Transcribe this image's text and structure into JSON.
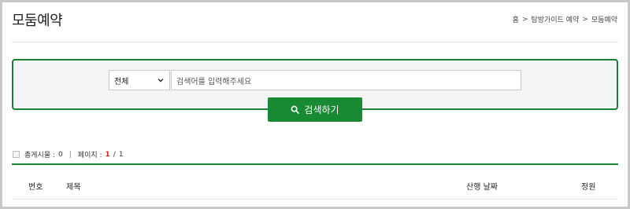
{
  "page": {
    "title": "모둠예약"
  },
  "breadcrumb": {
    "home": "홈",
    "level1": "탐방가이드 예약",
    "level2": "모둠예약"
  },
  "search": {
    "select_value": "전체",
    "input_placeholder": "검색어를 입력해주세요",
    "button_label": "검색하기"
  },
  "status": {
    "total_label": "총게시물 :",
    "total_value": "0",
    "page_label": "페이지 :",
    "current_page": "1",
    "page_sep": "/",
    "total_pages": "1"
  },
  "table": {
    "headers": {
      "number": "번호",
      "title": "제목",
      "date": "산행 날짜",
      "capacity": "정원"
    }
  },
  "colors": {
    "accent": "#178a33",
    "border_accent": "#1c7f34",
    "current_page": "#dd2222"
  },
  "icons": {
    "search": "search-icon",
    "select": "chevron-down-icon"
  }
}
